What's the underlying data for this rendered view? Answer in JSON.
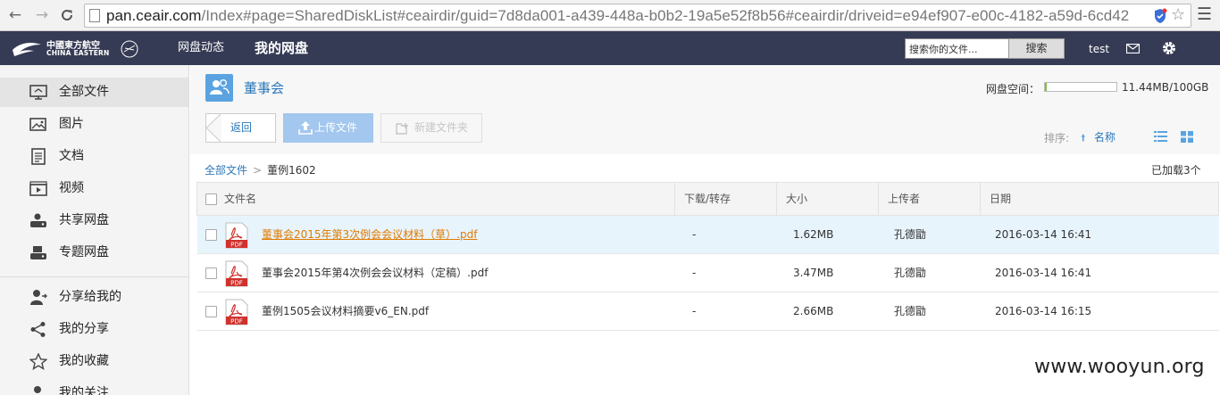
{
  "browser": {
    "url_host": "pan.ceair.com",
    "url_path": "/Index#page=SharedDiskList#ceairdir/guid=7d8da001-a439-448a-b0b2-19a5e52f8b56#ceairdir/driveid=e94ef907-e00c-4182-a59d-6cd42"
  },
  "header": {
    "logo_cn": "中國東方航空",
    "logo_en": "CHINA EASTERN",
    "nav": [
      "网盘动态",
      "我的网盘"
    ],
    "search_placeholder": "搜索你的文件...",
    "search_button": "搜索",
    "user": "test"
  },
  "sidebar": {
    "items": [
      {
        "label": "全部文件",
        "icon": "monitor-icon",
        "active": true
      },
      {
        "label": "图片",
        "icon": "image-icon"
      },
      {
        "label": "文档",
        "icon": "document-icon"
      },
      {
        "label": "视频",
        "icon": "video-icon"
      },
      {
        "label": "共享网盘",
        "icon": "shared-disk-icon"
      },
      {
        "label": "专题网盘",
        "icon": "topic-disk-icon"
      },
      {
        "label": "分享给我的",
        "icon": "shared-with-me-icon"
      },
      {
        "label": "我的分享",
        "icon": "share-icon"
      },
      {
        "label": "我的收藏",
        "icon": "star-icon"
      },
      {
        "label": "我的关注",
        "icon": "follow-icon"
      }
    ]
  },
  "folder": {
    "title": "董事会"
  },
  "quota": {
    "label": "网盘空间：",
    "value": "11.44MB/100GB",
    "used_fraction": 0.0001
  },
  "toolbar": {
    "back": "返回",
    "upload": "上传文件",
    "new_folder": "新建文件夹"
  },
  "sort": {
    "label": "排序:",
    "field": "名称"
  },
  "breadcrumb": {
    "root": "全部文件",
    "current": "董例1602"
  },
  "loaded_text": "已加载3个",
  "table": {
    "columns": [
      "文件名",
      "下载/转存",
      "大小",
      "上传者",
      "日期"
    ],
    "rows": [
      {
        "name": "董事会2015年第3次例会会议材料（草）.pdf",
        "download": "-",
        "size": "1.62MB",
        "uploader": "孔德勖",
        "date": "2016-03-14 16:41",
        "selected": true
      },
      {
        "name": "董事会2015年第4次例会会议材料（定稿）.pdf",
        "download": "-",
        "size": "3.47MB",
        "uploader": "孔德勖",
        "date": "2016-03-14 16:41"
      },
      {
        "name": "董例1505会议材料摘要v6_EN.pdf",
        "download": "-",
        "size": "2.66MB",
        "uploader": "孔德勖",
        "date": "2016-03-14 16:15"
      }
    ]
  },
  "watermark": "www.wooyun.org",
  "colors": {
    "header_bg": "#363b55",
    "accent": "#2b77b8",
    "selected_link": "#e07b00",
    "upload_btn": "#a3c7ee",
    "quota_fill": "#7cc242"
  }
}
